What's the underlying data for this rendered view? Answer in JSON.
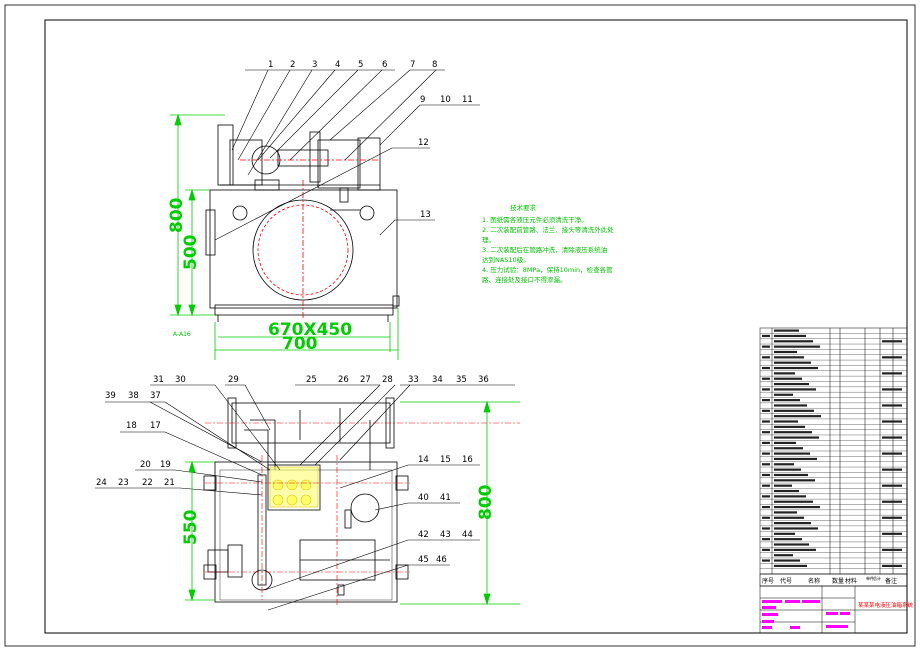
{
  "balloons": {
    "top": [
      "1",
      "2",
      "3",
      "4",
      "5",
      "6",
      "7",
      "8",
      "9",
      "10",
      "11",
      "12",
      "13"
    ],
    "bottom_left": [
      "39",
      "38",
      "37",
      "31",
      "30",
      "29",
      "25",
      "26",
      "27",
      "28",
      "33",
      "34",
      "35",
      "36"
    ],
    "bottom_mid": [
      "18",
      "17",
      "20",
      "19",
      "24",
      "23",
      "22",
      "21",
      "14",
      "15",
      "16",
      "40",
      "41",
      "42",
      "43",
      "44",
      "45",
      "46"
    ]
  },
  "dimensions": {
    "height_total": "800",
    "height_tank": "500",
    "footprint": "670X450",
    "width": "700",
    "height_plan": "550",
    "height_plan_total": "800",
    "section_mark": "A-A16"
  },
  "notes": {
    "title": "技术要求",
    "lines": [
      "1. 图纸需各液压元件必须清洗干净。",
      "2. 二次装配前管路、法兰、接头等清洗外此处",
      "理。",
      "3. 二次装配后在管路冲洗，清除液压系统油",
      "达到NAS10级。",
      "4. 压力试验：8MPa，保持10min，检查各管",
      "路、连接处及接口不得渗漏。"
    ]
  },
  "colors": {
    "outline": "#000000",
    "dimension": "#00cc00",
    "centerline": "#ff0000",
    "hatch": "#ffff00",
    "note_text": "#00c000",
    "title_block": "#ff00ff"
  },
  "title_block": {
    "headers": [
      "序号",
      "代号",
      "名称",
      "数量",
      "材料",
      "单件",
      "总计",
      "备注"
    ],
    "drawing_title": "某某某电液压油箱系统"
  }
}
